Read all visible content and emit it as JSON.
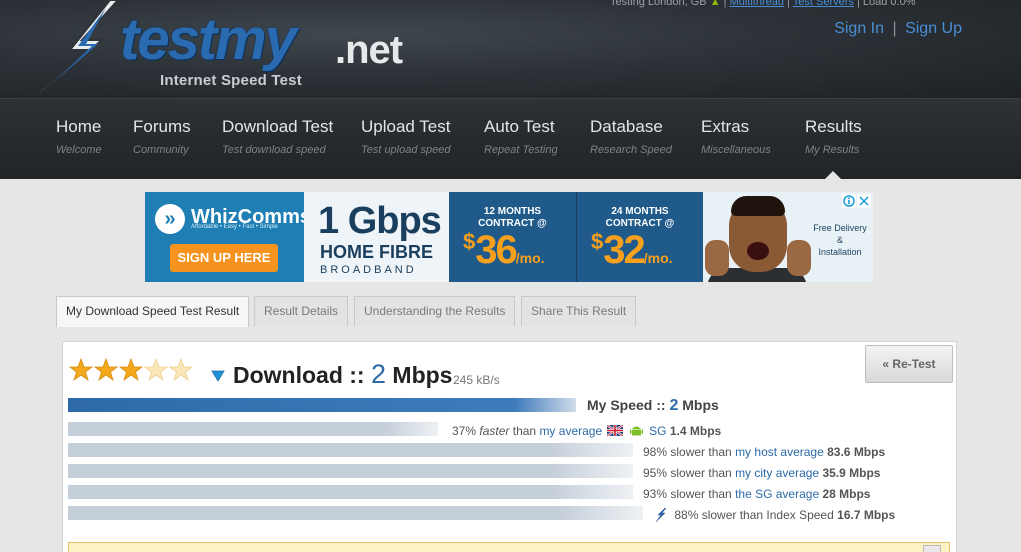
{
  "header": {
    "status_prefix": "Testing London, GB",
    "status_link1": "Multithread",
    "status_link2": "Test Servers",
    "status_load": "Load 0.0%",
    "logo_word": "testmy",
    "logo_tld": ".net",
    "logo_sub": "Internet Speed Test",
    "sign_in": "Sign In",
    "sign_up": "Sign Up",
    "separator": "|"
  },
  "nav": [
    {
      "title": "Home",
      "sub": "Welcome"
    },
    {
      "title": "Forums",
      "sub": "Community"
    },
    {
      "title": "Download Test",
      "sub": "Test download speed"
    },
    {
      "title": "Upload Test",
      "sub": "Test upload speed"
    },
    {
      "title": "Auto Test",
      "sub": "Repeat Testing"
    },
    {
      "title": "Database",
      "sub": "Research Speed"
    },
    {
      "title": "Extras",
      "sub": "Miscellaneous"
    },
    {
      "title": "Results",
      "sub": "My Results"
    }
  ],
  "ad": {
    "brand": "WhizComms",
    "tagline": "Affordable • Easy • Fast • Simple",
    "cta": "SIGN UP HERE",
    "big": "1 Gbps",
    "mid": "HOME FIBRE",
    "small": "BROADBAND",
    "offer1_line1": "12 MONTHS",
    "offer1_line2": "CONTRACT @",
    "offer1_currency": "$",
    "offer1_price": "36",
    "offer1_per": "/mo.",
    "offer2_line1": "24 MONTHS",
    "offer2_line2": "CONTRACT @",
    "offer2_currency": "$",
    "offer2_price": "32",
    "offer2_per": "/mo.",
    "delivery_line1": "Free Delivery",
    "delivery_line2": "&",
    "delivery_line3": "Installation"
  },
  "tabs": [
    "My Download Speed Test Result",
    "Result Details",
    "Understanding the Results",
    "Share This Result"
  ],
  "result": {
    "rating_stars": 3,
    "rating_max": 5,
    "title_prefix": "Download ::",
    "speed_value": "2",
    "speed_unit": "Mbps",
    "kbs": "245 kB/s",
    "retest": "« Re-Test",
    "my_speed_prefix": "My Speed ::",
    "my_speed_value": "2",
    "my_speed_unit": "Mbps",
    "comparisons": [
      {
        "percent_text": "37%",
        "qualifier": "faster",
        "than": "than",
        "link": "my average",
        "location": "SG",
        "value": "1.4 Mbps"
      },
      {
        "percent_text": "98% slower than",
        "link": "my host average",
        "value": "83.6 Mbps"
      },
      {
        "percent_text": "95% slower than",
        "link": "my city average",
        "value": "35.9 Mbps"
      },
      {
        "percent_text": "93% slower than",
        "link": "the SG average",
        "value": "28 Mbps"
      },
      {
        "percent_text": "88% slower than Index Speed",
        "link": "",
        "value": "16.7 Mbps"
      }
    ]
  },
  "colors": {
    "accent_blue": "#2c6aa8",
    "link_blue": "#4a8fd6",
    "star_gold": "#f3a91b"
  }
}
